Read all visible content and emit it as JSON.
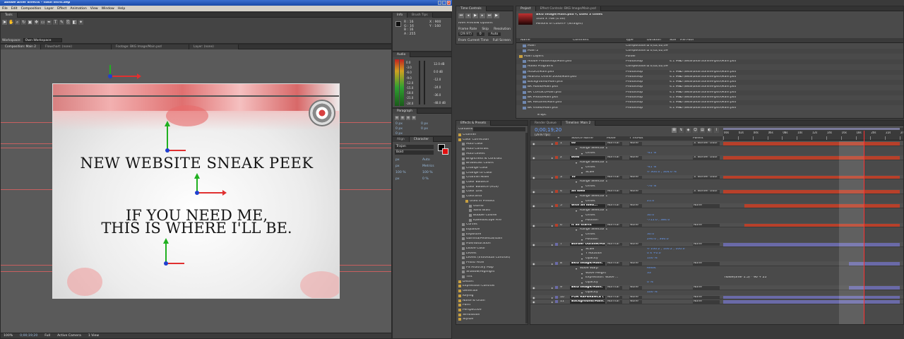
{
  "app": {
    "title": "Adobe After Effects - flash intro.aep",
    "close_glyph": "✕",
    "menu": [
      "File",
      "Edit",
      "Composition",
      "Layer",
      "Effect",
      "Animation",
      "View",
      "Window",
      "Help"
    ],
    "tools_label": "Tools",
    "workspace_label": "Workspace:",
    "workspace_value": "Own Workspace"
  },
  "composition": {
    "tabs": [
      "Composition: Main 2",
      "Flowchart: (none)",
      "Footage: BKG Image/Main.psd",
      "Layer: (none)"
    ],
    "headline": "NEW WEBSITE SNEAK PEEK",
    "line1": "IF YOU NEED ME,",
    "line2": "THIS IS WHERE I'LL BE.",
    "footer": [
      "100%",
      "0;00;19;20",
      "Full",
      "Active Camera",
      "1 View"
    ]
  },
  "info": {
    "tabs": [
      "Info",
      "Brush Tips"
    ],
    "rows": [
      "R : 16",
      "G : 16",
      "B : 16",
      "A : 255",
      "X : 900",
      "Y : 160"
    ]
  },
  "audio": {
    "tab": "Audio",
    "db_labels": [
      "0.0",
      "-3.0",
      "-6.0",
      "-9.0",
      "-12.0",
      "-15.0",
      "-18.0",
      "-21.0",
      "-24.0"
    ],
    "right_labels": [
      "12.0 dB",
      "0.0 dB",
      "-12.0",
      "-24.0",
      "-36.0",
      "-48.0 dB"
    ]
  },
  "paragraph": {
    "tab": "Paragraph",
    "fields": [
      "0 px",
      "0 px",
      "0 px",
      "0 px",
      "0 px"
    ]
  },
  "character": {
    "tabs": [
      "Align",
      "Character"
    ],
    "font": "Trajan",
    "style": "Bold",
    "fields": [
      "px",
      "Auto",
      "px",
      "Metrics",
      "100 %",
      "100 %",
      "px",
      "0 %"
    ]
  },
  "time_controls": {
    "tab": "Time Controls",
    "options": "RAM Preview Options",
    "labels": [
      "Frame Rate",
      "Skip",
      "Resolution"
    ],
    "values": [
      "(29.97)",
      "0",
      "Auto"
    ],
    "checks": [
      "From Current Time",
      "Full Screen"
    ]
  },
  "project": {
    "tabs": [
      "Project",
      "Effect Controls: BKG Image/Main.psd"
    ],
    "item_name": "BKG Image/Main.psd ▾, used 3 times",
    "item_dims": "1024 x 768 (1.00)",
    "item_colors": "Millions of Colors+ (Straight)",
    "columns": [
      "Name",
      "Comment",
      "Type",
      "Duration",
      "Size",
      "File Path"
    ],
    "rows": [
      {
        "name": "Main",
        "type": "Composition",
        "dur": "Δ 0;02;02;09",
        "size": "",
        "path": ""
      },
      {
        "name": "Main 2",
        "type": "Composition",
        "dur": "Δ 0;02;02;09",
        "size": "",
        "path": ""
      },
      {
        "name": "Main Layers",
        "type": "Folder",
        "dur": "",
        "size": "",
        "path": ""
      },
      {
        "name": "Adobe Photoshop/Main.psd",
        "type": "Photoshop",
        "dur": "",
        "size": "4.1 MB",
        "path": "D:\\WEB\\avartsonline\\psd\\Main.psd"
      },
      {
        "name": "Audio Programs",
        "type": "Composition",
        "dur": "Δ 0;02;02;09",
        "size": "",
        "path": ""
      },
      {
        "name": "AUDIO/Main.psd",
        "type": "Photoshop",
        "dur": "",
        "size": "4.1 MB",
        "path": "D:\\WEB\\avartsonline\\psd\\Main.psd"
      },
      {
        "name": "Avartist Online 2006/Main.psd",
        "type": "Photoshop",
        "dur": "",
        "size": "4.1 MB",
        "path": "D:\\WEB\\avartsonline\\psd\\Main.psd"
      },
      {
        "name": "Background/Main.psd",
        "type": "Photoshop",
        "dur": "",
        "size": "4.1 MB",
        "path": "D:\\WEB\\avartsonline\\psd\\Main.psd"
      },
      {
        "name": "BK Audio/Main.psd",
        "type": "Photoshop",
        "dur": "",
        "size": "4.1 MB",
        "path": "D:\\WEB\\avartsonline\\psd\\Main.psd"
      },
      {
        "name": "BK Contact/Main.psd",
        "type": "Photoshop",
        "dur": "",
        "size": "4.1 MB",
        "path": "D:\\WEB\\avartsonline\\psd\\Main.psd"
      },
      {
        "name": "BK Photo/Main.psd",
        "type": "Photoshop",
        "dur": "",
        "size": "4.1 MB",
        "path": "D:\\WEB\\avartsonline\\psd\\Main.psd"
      },
      {
        "name": "BK Resume/Main.psd",
        "type": "Photoshop",
        "dur": "",
        "size": "4.1 MB",
        "path": "D:\\WEB\\avartsonline\\psd\\Main.psd"
      },
      {
        "name": "BK Video/Main.psd",
        "type": "Photoshop",
        "dur": "",
        "size": "4.1 MB",
        "path": "D:\\WEB\\avartsonline\\psd\\Main.psd"
      }
    ],
    "footer": "8 bpc"
  },
  "effects": {
    "tab": "Effects & Presets",
    "contains_label": "Contains:",
    "items": [
      {
        "t": "Channel",
        "lvl": 0
      },
      {
        "t": "Color Correction",
        "lvl": 0
      },
      {
        "t": "Auto Color",
        "lvl": 1
      },
      {
        "t": "Auto Contrast",
        "lvl": 1
      },
      {
        "t": "Auto Levels",
        "lvl": 1
      },
      {
        "t": "Brightness & Contrast",
        "lvl": 1
      },
      {
        "t": "Broadcast Colors",
        "lvl": 1
      },
      {
        "t": "Change Color",
        "lvl": 1
      },
      {
        "t": "Change to Color",
        "lvl": 1
      },
      {
        "t": "Channel Mixer",
        "lvl": 1
      },
      {
        "t": "Color Balance",
        "lvl": 1
      },
      {
        "t": "Color Balance (HLS)",
        "lvl": 1
      },
      {
        "t": "Color Link",
        "lvl": 1
      },
      {
        "t": "Colorama",
        "lvl": 1
      },
      {
        "t": "Used In Presets",
        "lvl": 2
      },
      {
        "t": "Gizmo",
        "lvl": 3
      },
      {
        "t": "Sand Blast",
        "lvl": 3
      },
      {
        "t": "Bubble Colorer",
        "lvl": 3
      },
      {
        "t": "Kaleidoscope Fire",
        "lvl": 3
      },
      {
        "t": "Curves",
        "lvl": 1
      },
      {
        "t": "Equalize",
        "lvl": 1
      },
      {
        "t": "Exposure",
        "lvl": 1
      },
      {
        "t": "Gamma/Pedestal/Gain",
        "lvl": 1
      },
      {
        "t": "Hue/Saturation",
        "lvl": 1
      },
      {
        "t": "Leave Color",
        "lvl": 1
      },
      {
        "t": "Levels",
        "lvl": 1
      },
      {
        "t": "Levels (Individual Controls)",
        "lvl": 1
      },
      {
        "t": "Photo Filter",
        "lvl": 1
      },
      {
        "t": "PS Arbitrary Map",
        "lvl": 1
      },
      {
        "t": "Shadow/Highlight",
        "lvl": 1
      },
      {
        "t": "Tint",
        "lvl": 1
      },
      {
        "t": "Distort",
        "lvl": 0
      },
      {
        "t": "Expression Controls",
        "lvl": 0
      },
      {
        "t": "Generate",
        "lvl": 0
      },
      {
        "t": "Keying",
        "lvl": 0
      },
      {
        "t": "Noise & Grain",
        "lvl": 0
      },
      {
        "t": "Paint",
        "lvl": 0
      },
      {
        "t": "Perspective",
        "lvl": 0
      },
      {
        "t": "Simulation",
        "lvl": 0
      },
      {
        "t": "Stylize",
        "lvl": 0
      }
    ]
  },
  "timeline": {
    "tabs": [
      "Render Queue",
      "Timeline: Main 2"
    ],
    "timecode": "0;00;19;20",
    "fps": "(29.97 fps)",
    "columns": [
      "#",
      "Source Name",
      "Mode",
      "T TrkMat",
      "Parent"
    ],
    "ruler": [
      "00s",
      "02s",
      "04s",
      "06s",
      "08s",
      "10s",
      "12s",
      "14s",
      "16s",
      "18s",
      "20s",
      "22s",
      "24s"
    ],
    "rows": [
      {
        "k": "layer",
        "num": "1",
        "name": "so",
        "mode": "Normal",
        "trk": "None",
        "parent": "3. Border Outli",
        "bar": "#b8402a",
        "bar_start": 0,
        "bar_end": 1
      },
      {
        "k": "prop",
        "name": "Range Selector 1"
      },
      {
        "k": "prop2",
        "name": "Offset",
        "val": "-41 %"
      },
      {
        "k": "layer",
        "num": "2",
        "name": "bold",
        "mode": "Normal",
        "trk": "None",
        "parent": "3. Border Outli",
        "bar": "#b8402a",
        "bar_start": 0,
        "bar_end": 1
      },
      {
        "k": "prop",
        "name": "Range Selector 1"
      },
      {
        "k": "prop2",
        "name": "Offset",
        "val": "-41 %"
      },
      {
        "k": "prop2",
        "name": "Scale",
        "val": "∞ 304.0 , 304.0 %"
      },
      {
        "k": "layer",
        "num": "3",
        "name": "To",
        "mode": "Normal",
        "trk": "None",
        "parent": "3. Border Outli",
        "bar": "#b8402a",
        "bar_start": 0,
        "bar_end": 1
      },
      {
        "k": "prop",
        "name": "Range Selector 1"
      },
      {
        "k": "prop2",
        "name": "Offset",
        "val": "-76 %"
      },
      {
        "k": "layer",
        "num": "4",
        "name": "an idea",
        "mode": "Normal",
        "trk": "None",
        "parent": "3. Border Outli",
        "bar": "#b8402a",
        "bar_start": 0,
        "bar_end": 1
      },
      {
        "k": "prop",
        "name": "Range Selector 1"
      },
      {
        "k": "prop2",
        "name": "Offset",
        "val": "21.0"
      },
      {
        "k": "layer",
        "num": "5",
        "name": "with an idea...",
        "mode": "Normal",
        "trk": "None",
        "parent": "None",
        "bar": "#b8402a",
        "bar_start": 0.12,
        "bar_end": 1
      },
      {
        "k": "prop",
        "name": "Range Selector 1"
      },
      {
        "k": "prop2",
        "name": "Offset",
        "val": "30.0"
      },
      {
        "k": "prop2",
        "name": "Position",
        "val": "-715.0 , 384.0"
      },
      {
        "k": "layer",
        "num": "6",
        "name": "It all starts",
        "mode": "Normal",
        "trk": "None",
        "parent": "None",
        "bar": "#b8402a",
        "bar_start": 0.12,
        "bar_end": 1
      },
      {
        "k": "prop",
        "name": "Range Selector 1"
      },
      {
        "k": "prop2",
        "name": "Offset",
        "val": "30.0"
      },
      {
        "k": "prop2",
        "name": "Position",
        "val": "290.0 , 360.0"
      },
      {
        "k": "layer",
        "num": "7",
        "name": "Border Outline/Ma",
        "mode": "Normal",
        "trk": "None",
        "parent": "None",
        "bar": "#6a6aa8",
        "bar_start": 0,
        "bar_end": 1
      },
      {
        "k": "prop2",
        "name": "Scale",
        "val": "∞ 100.2 , 100.2 , 100.0"
      },
      {
        "k": "prop2",
        "name": "Y Rotation",
        "val": "0 x +0.0°"
      },
      {
        "k": "prop2",
        "name": "Opacity",
        "val": "100 %"
      },
      {
        "k": "layer",
        "num": "8",
        "name": "BKG Image/Main.",
        "mode": "Normal",
        "trk": "None",
        "parent": "None",
        "bar": "#6a6aa8",
        "bar_start": 0.71,
        "bar_end": 1
      },
      {
        "k": "prop",
        "name": "Wave Warp",
        "val": "Reset"
      },
      {
        "k": "prop2",
        "name": "Wave Height",
        "val": "33"
      },
      {
        "k": "prop2",
        "name": "Expression: Wave ...",
        "val": "",
        "expr": "noise(time*1.5) * 90 + 25"
      },
      {
        "k": "prop2",
        "name": "Opacity",
        "val": "0 %"
      },
      {
        "k": "layer",
        "num": "9",
        "name": "BKG Image/Main.",
        "mode": "Normal",
        "trk": "None",
        "parent": "None",
        "bar": "#6a6aa8",
        "bar_start": 0.71,
        "bar_end": 1
      },
      {
        "k": "prop2",
        "name": "Opacity",
        "val": "100 %"
      },
      {
        "k": "layer",
        "num": "10",
        "name": "FOR REFERENCE (",
        "mode": "Normal",
        "trk": "None",
        "parent": "None",
        "bar": "#6a6aa8",
        "bar_start": 0,
        "bar_end": 1
      },
      {
        "k": "layer",
        "num": "11",
        "name": "Background/Main.",
        "mode": "Normal",
        "trk": "None",
        "parent": "None",
        "bar": "#6a6aa8",
        "bar_start": 0,
        "bar_end": 1
      }
    ]
  },
  "colors": {
    "accent": "#1f63b0",
    "layer_red": "#b8402a",
    "layer_blue": "#6a6aa8",
    "cti": "#ff3030"
  }
}
